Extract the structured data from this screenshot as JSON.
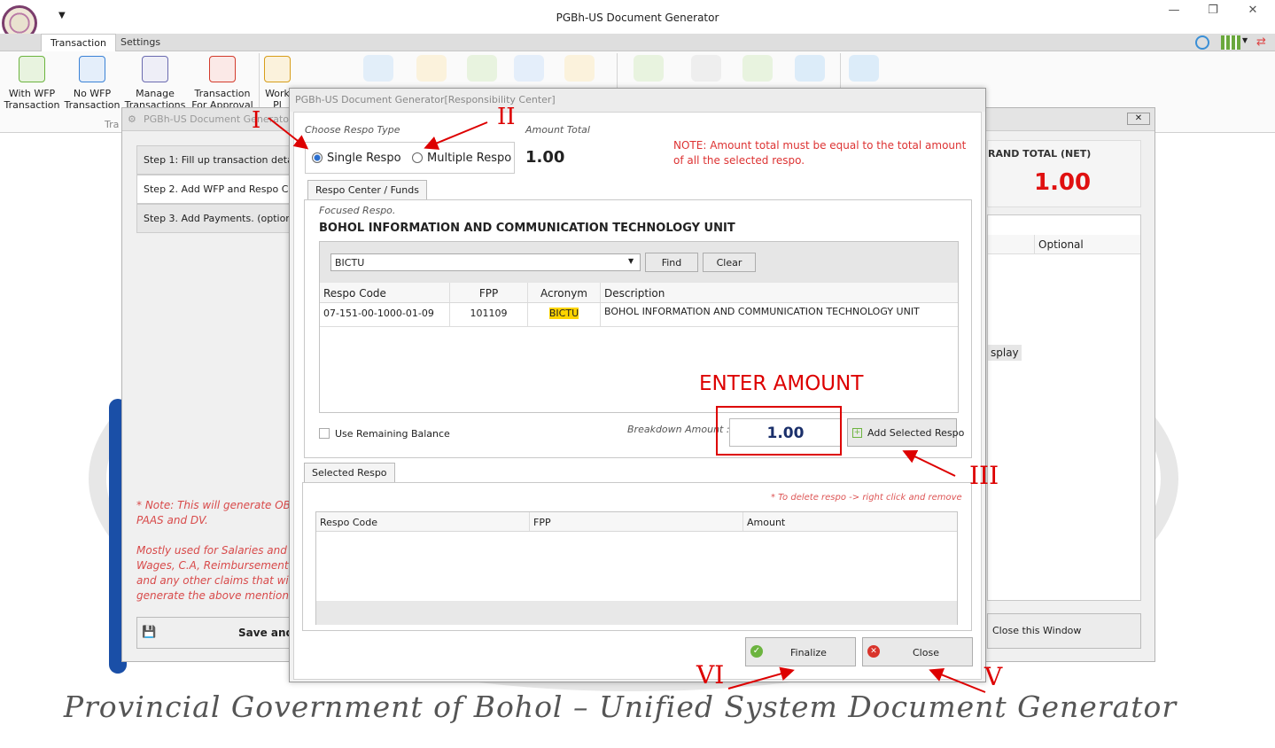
{
  "window": {
    "title": "PGBh-US Document Generator",
    "min": "—",
    "restore": "❐",
    "close": "✕"
  },
  "tabs": {
    "transaction": "Transaction",
    "settings": "Settings"
  },
  "ribbon": {
    "buttons": [
      {
        "label": "With WFP\nTransaction",
        "color": "#6cb43f"
      },
      {
        "label": "No WFP\nTransaction",
        "color": "#3b82d6"
      },
      {
        "label": "Manage\nTransactions",
        "color": "#6b6bb0"
      },
      {
        "label": "Transaction\nFor Approval",
        "color": "#d33b2c"
      },
      {
        "label": "Work\nPl",
        "color": "#d79d1a"
      }
    ],
    "group_label": "Tra"
  },
  "back_window": {
    "title": "PGBh-US Document Generato",
    "steps": [
      "Step 1: Fill up transaction detail",
      "Step 2. Add WFP and Respo Cente",
      "Step 3. Add Payments. (optional)"
    ],
    "note": "* Note: This will generate OB PAAS and DV.\n\nMostly used for Salaries and Wages, C.A, Reimbursement and any other claims that wi generate the above mention.",
    "save_label": "Save and",
    "grand_total_label": "RAND TOTAL (NET)",
    "grand_total_value": "1.00",
    "optional_col": "Optional",
    "display_text": "splay",
    "close_window_label": "Close this Window"
  },
  "modal": {
    "title": "PGBh-US Document Generator[Responsibility Center]",
    "choose_type_label": "Choose Respo Type",
    "single_label": "Single Respo",
    "multiple_label": "Multiple Respo",
    "amount_total_label": "Amount Total",
    "amount_total_value": "1.00",
    "note": "NOTE: Amount total must be equal to the total amount of all the selected respo.",
    "respo_tab": "Respo Center / Funds",
    "focused_label": "Focused Respo.",
    "focused_name": "BOHOL INFORMATION AND COMMUNICATION TECHNOLOGY UNIT",
    "search_value": "BICTU",
    "find_label": "Find",
    "clear_label": "Clear",
    "columns": [
      "Respo Code",
      "FPP",
      "Acronym",
      "Description"
    ],
    "rows": [
      [
        "07-151-00-1000-01-09",
        "101109",
        "BICTU",
        "BOHOL INFORMATION AND COMMUNICATION TECHNOLOGY UNIT"
      ]
    ],
    "use_remaining_label": "Use Remaining Balance",
    "breakdown_label": "Breakdown Amount :",
    "breakdown_value": "1.00",
    "add_selected_label": "Add Selected Respo",
    "selected_tab": "Selected Respo",
    "delete_hint": "* To delete respo -> right click and remove",
    "selected_columns": [
      "Respo Code",
      "FPP",
      "Amount"
    ],
    "finalize_label": "Finalize",
    "close_label": "Close"
  },
  "annotations": {
    "enter_amount": "ENTER AMOUNT",
    "i": "I",
    "ii": "II",
    "iii": "III",
    "v": "V",
    "vi": "VI"
  },
  "footer": "Provincial Government of Bohol – Unified System Document Generator"
}
